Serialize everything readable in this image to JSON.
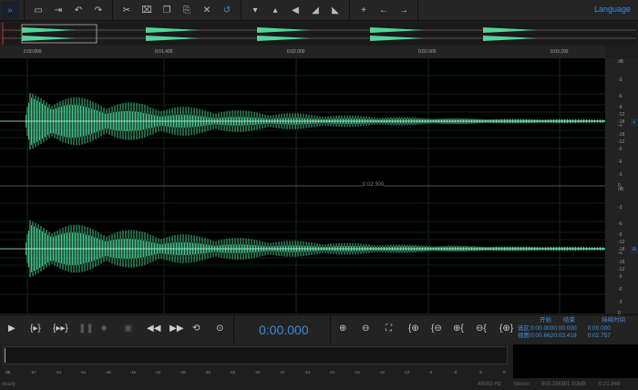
{
  "toolbar": {
    "language": "Language",
    "icons": [
      "expand-icon",
      "open-icon",
      "export-icon",
      "undo-icon",
      "redo-icon",
      "cut-icon",
      "crop-icon",
      "copy-icon",
      "paste-icon",
      "delete-icon",
      "revert-icon",
      "volume-down-icon",
      "volume-up-icon",
      "speaker-icon",
      "fade-in-icon",
      "fade-out-icon",
      "add-icon",
      "arrow-left-icon",
      "arrow-right-icon"
    ]
  },
  "ruler": {
    "labels": [
      "0:00.800",
      "0:01.400",
      "0:02.000",
      "0:02.600",
      "0:03.200"
    ]
  },
  "cursor_label": "0:02.300",
  "scale": {
    "labels": [
      "dB",
      "-3",
      "-6",
      "-9",
      "-12",
      "-18",
      "-∞",
      "-18",
      "-12",
      "-9",
      "-6",
      "-3",
      "0"
    ],
    "channels": [
      "L",
      "R"
    ]
  },
  "transport": {
    "time": "0:00.000"
  },
  "selection": {
    "col_start": "开始",
    "col_end": "结束",
    "col_duration": "持续时间",
    "rows": [
      {
        "label": "选区",
        "start": "0:00.000",
        "end": "0:00.000",
        "duration": "0:00.000"
      },
      {
        "label": "视图",
        "start": "0:00.662",
        "end": "0:03.419",
        "duration": "0:02.757"
      }
    ]
  },
  "meter": {
    "ticks": [
      "dB",
      "-57",
      "-54",
      "-51",
      "-48",
      "-45",
      "-42",
      "-39",
      "-36",
      "-33",
      "-30",
      "-27",
      "-24",
      "-21",
      "-18",
      "-15",
      "-12",
      "-9",
      "-6",
      "-3",
      "0"
    ]
  },
  "status": {
    "state": "ready",
    "rate": "48000 Hz",
    "channels": "Stereo",
    "size": "500.15KB/1.00MB",
    "duration": "0:21.848"
  },
  "colors": {
    "wave": "#4fd69a",
    "accent": "#3a8ad8"
  }
}
